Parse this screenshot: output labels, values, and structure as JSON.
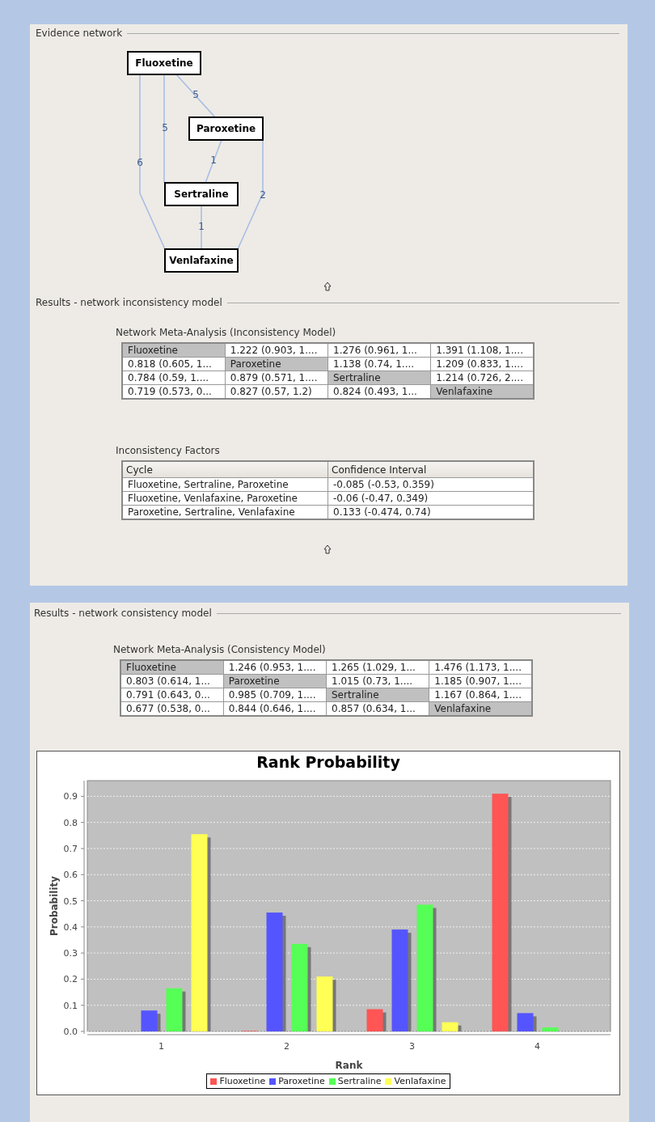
{
  "evidence_network": {
    "title": "Evidence network",
    "nodes": [
      {
        "label": "Fluoxetine"
      },
      {
        "label": "Paroxetine"
      },
      {
        "label": "Sertraline"
      },
      {
        "label": "Venlafaxine"
      }
    ],
    "edges": [
      {
        "label": "5"
      },
      {
        "label": "5"
      },
      {
        "label": "6"
      },
      {
        "label": "1"
      },
      {
        "label": "1"
      },
      {
        "label": "2"
      }
    ]
  },
  "inconsistency_results": {
    "title": "Results - network inconsistency model",
    "meta_analysis": {
      "title": "Network Meta-Analysis (Inconsistency Model)",
      "rows": [
        [
          {
            "kind": "treatment",
            "text": "Fluoxetine"
          },
          {
            "kind": "value",
            "text": "1.222 (0.903, 1...."
          },
          {
            "kind": "value",
            "text": "1.276 (0.961, 1..."
          },
          {
            "kind": "value",
            "text": "1.391 (1.108, 1...."
          }
        ],
        [
          {
            "kind": "value",
            "text": "0.818 (0.605, 1..."
          },
          {
            "kind": "treatment",
            "text": "Paroxetine"
          },
          {
            "kind": "value",
            "text": "1.138 (0.74, 1...."
          },
          {
            "kind": "value",
            "text": "1.209 (0.833, 1...."
          }
        ],
        [
          {
            "kind": "value",
            "text": "0.784 (0.59, 1...."
          },
          {
            "kind": "value",
            "text": "0.879 (0.571, 1...."
          },
          {
            "kind": "treatment",
            "text": "Sertraline"
          },
          {
            "kind": "value",
            "text": "1.214 (0.726, 2...."
          }
        ],
        [
          {
            "kind": "value",
            "text": "0.719 (0.573, 0..."
          },
          {
            "kind": "value",
            "text": "0.827 (0.57, 1.2)"
          },
          {
            "kind": "value",
            "text": "0.824 (0.493, 1..."
          },
          {
            "kind": "treatment",
            "text": "Venlafaxine"
          }
        ]
      ]
    },
    "inconsistency_factors": {
      "title": "Inconsistency Factors",
      "columns": [
        "Cycle",
        "Confidence Interval"
      ],
      "rows": [
        [
          "Fluoxetine, Sertraline, Paroxetine",
          "-0.085 (-0.53, 0.359)"
        ],
        [
          "Fluoxetine, Venlafaxine, Paroxetine",
          "-0.06 (-0.47, 0.349)"
        ],
        [
          "Paroxetine, Sertraline, Venlafaxine",
          "0.133 (-0.474, 0.74)"
        ]
      ]
    }
  },
  "consistency_results": {
    "title": "Results - network consistency model",
    "meta_analysis": {
      "title": "Network Meta-Analysis (Consistency Model)",
      "rows": [
        [
          {
            "kind": "treatment",
            "text": "Fluoxetine"
          },
          {
            "kind": "value",
            "text": "1.246 (0.953, 1...."
          },
          {
            "kind": "value",
            "text": "1.265 (1.029, 1..."
          },
          {
            "kind": "value",
            "text": "1.476 (1.173, 1...."
          }
        ],
        [
          {
            "kind": "value",
            "text": "0.803 (0.614, 1..."
          },
          {
            "kind": "treatment",
            "text": "Paroxetine"
          },
          {
            "kind": "value",
            "text": "1.015 (0.73, 1...."
          },
          {
            "kind": "value",
            "text": "1.185 (0.907, 1...."
          }
        ],
        [
          {
            "kind": "value",
            "text": "0.791 (0.643, 0..."
          },
          {
            "kind": "value",
            "text": "0.985 (0.709, 1...."
          },
          {
            "kind": "treatment",
            "text": "Sertraline"
          },
          {
            "kind": "value",
            "text": "1.167 (0.864, 1...."
          }
        ],
        [
          {
            "kind": "value",
            "text": "0.677 (0.538, 0..."
          },
          {
            "kind": "value",
            "text": "0.844 (0.646, 1...."
          },
          {
            "kind": "value",
            "text": "0.857 (0.634, 1..."
          },
          {
            "kind": "treatment",
            "text": "Venlafaxine"
          }
        ]
      ]
    },
    "rank_chart": {
      "chart_data": {
        "type": "bar",
        "title": "Rank Probability",
        "xlabel": "Rank",
        "ylabel": "Probability",
        "categories": [
          "1",
          "2",
          "3",
          "4"
        ],
        "series": [
          {
            "name": "Fluoxetine",
            "color": "#ff5555",
            "values": [
              0,
              0.002,
              0.085,
              0.91
            ]
          },
          {
            "name": "Paroxetine",
            "color": "#5555ff",
            "values": [
              0.08,
              0.455,
              0.39,
              0.07
            ]
          },
          {
            "name": "Sertraline",
            "color": "#55ff55",
            "values": [
              0.165,
              0.335,
              0.485,
              0.015
            ]
          },
          {
            "name": "Venlafaxine",
            "color": "#ffff55",
            "values": [
              0.755,
              0.21,
              0.035,
              0
            ]
          }
        ],
        "ylim": [
          0,
          0.96
        ],
        "grid": true,
        "legend": true,
        "yticks": [
          {
            "value": 0,
            "label": "0.0"
          },
          {
            "value": 0.1,
            "label": "0.1"
          },
          {
            "value": 0.2,
            "label": "0.2"
          },
          {
            "value": 0.3,
            "label": "0.3"
          },
          {
            "value": 0.4,
            "label": "0.4"
          },
          {
            "value": 0.5,
            "label": "0.5"
          },
          {
            "value": 0.6,
            "label": "0.6"
          },
          {
            "value": 0.7,
            "label": "0.7"
          },
          {
            "value": 0.8,
            "label": "0.8"
          },
          {
            "value": 0.9,
            "label": "0.9"
          }
        ]
      }
    }
  }
}
